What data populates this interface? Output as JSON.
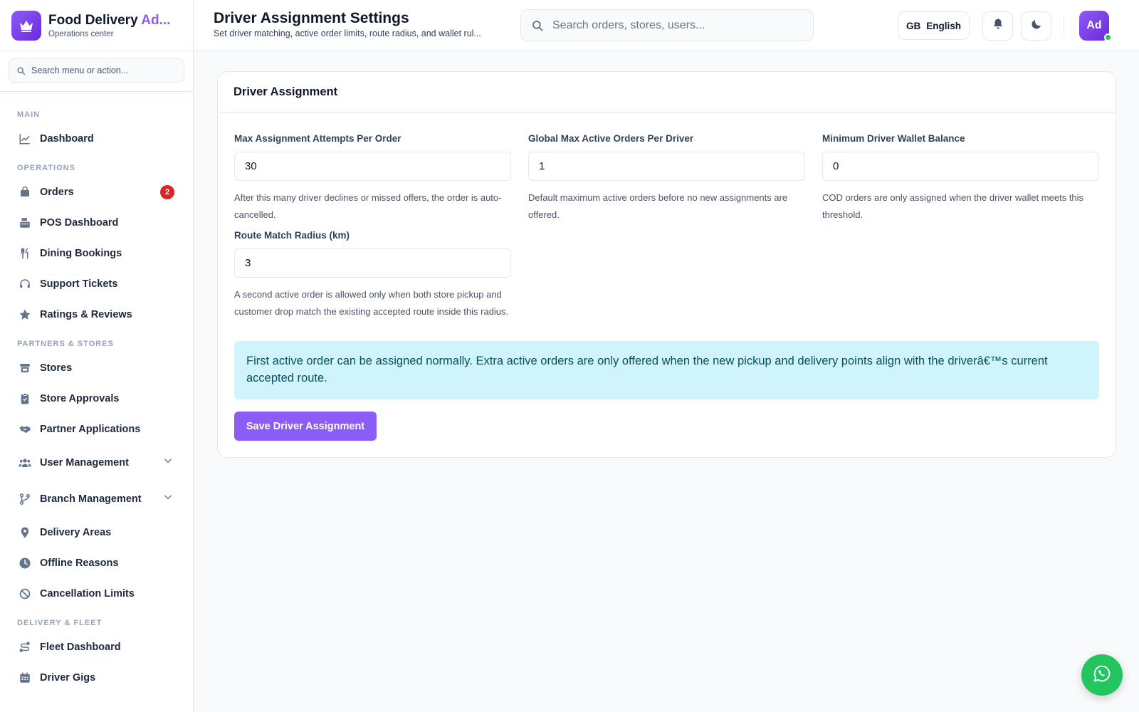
{
  "brand": {
    "title_main": "Food Delivery ",
    "title_accent": "Ad...",
    "subtitle": "Operations center",
    "logo_icon": "crown-icon"
  },
  "sidebar": {
    "search_placeholder": "Search menu or action...",
    "sections": {
      "main": "MAIN",
      "operations": "OPERATIONS",
      "partners": "PARTNERS & STORES",
      "fleet": "DELIVERY & FLEET"
    },
    "items": {
      "dashboard": "Dashboard",
      "orders": "Orders",
      "orders_badge": "2",
      "pos_dashboard": "POS Dashboard",
      "dining_bookings": "Dining Bookings",
      "support_tickets": "Support Tickets",
      "ratings_reviews": "Ratings & Reviews",
      "stores": "Stores",
      "store_approvals": "Store Approvals",
      "partner_applications": "Partner Applications",
      "user_management": "User Management",
      "branch_management": "Branch Management",
      "delivery_areas": "Delivery Areas",
      "offline_reasons": "Offline Reasons",
      "cancellation_limits": "Cancellation Limits",
      "fleet_dashboard": "Fleet Dashboard",
      "driver_gigs": "Driver Gigs"
    }
  },
  "header": {
    "title": "Driver Assignment Settings",
    "subtitle": "Set driver matching, active order limits, route radius, and wallet rul...",
    "search_placeholder": "Search orders, stores, users...",
    "lang_code": "GB",
    "lang_label": "English",
    "avatar_initials": "Ad"
  },
  "card": {
    "title": "Driver Assignment",
    "fields": {
      "max_attempts": {
        "label": "Max Assignment Attempts Per Order",
        "value": "30",
        "help": "After this many driver declines or missed offers, the order is auto-cancelled."
      },
      "max_active": {
        "label": "Global Max Active Orders Per Driver",
        "value": "1",
        "help": "Default maximum active orders before no new assignments are offered."
      },
      "min_wallet": {
        "label": "Minimum Driver Wallet Balance",
        "value": "0",
        "help": "COD orders are only assigned when the driver wallet meets this threshold."
      },
      "route_radius": {
        "label": "Route Match Radius (km)",
        "value": "3",
        "help": "A second active order is allowed only when both store pickup and customer drop match the existing accepted route inside this radius."
      }
    },
    "info": "First active order can be assigned normally. Extra active orders are only offered when the new pickup and delivery points align with the driverâ€™s current accepted route.",
    "save_label": "Save Driver Assignment"
  },
  "colors": {
    "accent": "#8b5cf6",
    "badge": "#dc2626",
    "info_bg": "#cff4fc",
    "info_text": "#055160",
    "whatsapp": "#22c55e"
  }
}
